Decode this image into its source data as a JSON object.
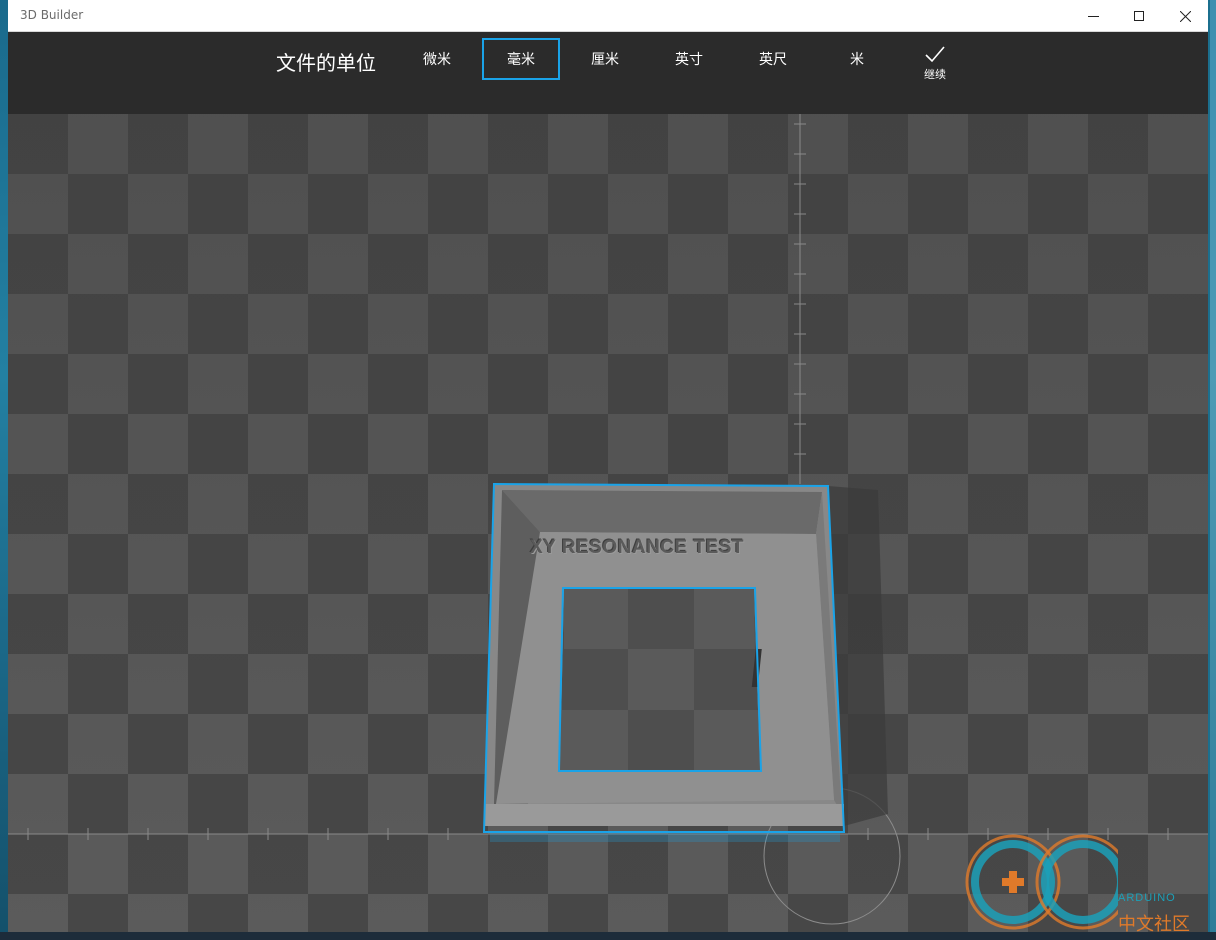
{
  "window": {
    "title": "3D Builder"
  },
  "window_controls": {
    "minimize": "—",
    "maximize": "☐",
    "close": "✕"
  },
  "unit_toolbar": {
    "heading": "文件的单位",
    "units": [
      {
        "label": "微米",
        "selected": false
      },
      {
        "label": "毫米",
        "selected": true
      },
      {
        "label": "厘米",
        "selected": false
      },
      {
        "label": "英寸",
        "selected": false
      },
      {
        "label": "英尺",
        "selected": false
      },
      {
        "label": "米",
        "selected": false
      }
    ],
    "continue_label": "继续",
    "accent_color": "#1aa3e8"
  },
  "model": {
    "engraved_text": "XY RESONANCE TEST",
    "selection_color": "#1aa3e8"
  },
  "watermark": {
    "brand": "ARDUINO",
    "site": "中文社区"
  }
}
